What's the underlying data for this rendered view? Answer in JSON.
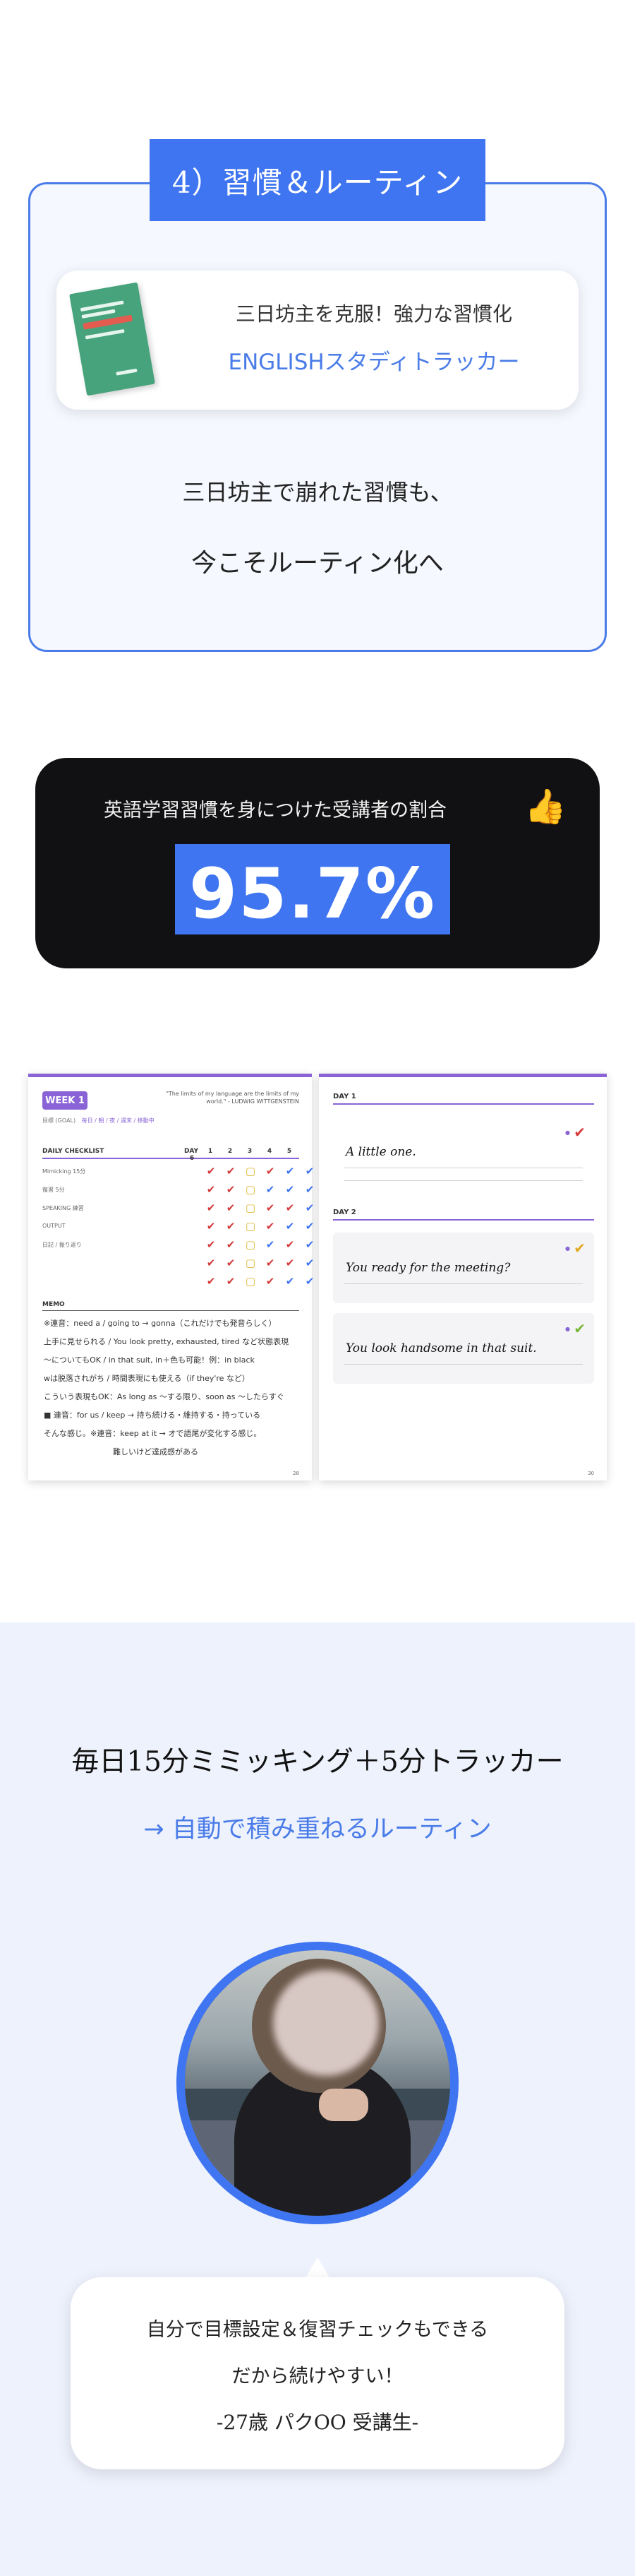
{
  "section1": {
    "title": "4）習慣＆ルーティン",
    "tracker_line1": "三日坊主を克服！強力な習慣化",
    "tracker_line2": "ENGLISHスタディトラッカー",
    "message_line1": "三日坊主で崩れた習慣も、",
    "message_line2": "今こそルーティン化へ"
  },
  "stat": {
    "label": "英語学習習慣を身につけた受講者の割合",
    "icon": "thumbs-up-icon",
    "value": "95.7%"
  },
  "worksheet": {
    "left": {
      "week": "WEEK 1",
      "quote": "\"The limits of my language are the limits of my world.\" - LUDWIG WITTGENSTEIN",
      "goal_label": "目標 (GOAL)",
      "goal_tags": "毎日 / 朝 / 夜 / 週末 / 移動中",
      "checklist_title": "DAILY CHECKLIST",
      "day_label": "DAY",
      "days": [
        "1",
        "2",
        "3",
        "4",
        "5",
        "6"
      ],
      "checklist_items": [
        "Mimicking 15分",
        "復習 5分",
        "SPEAKING 練習",
        "OUTPUT",
        "日記 / 振り返り",
        "",
        ""
      ],
      "memo_title": "MEMO",
      "memo_lines": [
        "※連音：need a / going to → gonna（これだけでも発音らしく）",
        "上手に見せられる / You look pretty, exhausted, tired など状態表現",
        "～についてもOK / in that suit, in＋色も可能！例：in black",
        "wは脱落されがち / 時間表現にも使える（if they're など）",
        "こういう表現もOK：As long as ～する限り、soon as ～したらすぐ",
        "■ 連音：for us / keep → 持ち続ける・維持する・持っている",
        "そんな感じ。※連音：keep at it → オで語尾が変化する感じ。",
        "難しいけど達成感がある"
      ],
      "page": "28"
    },
    "right": {
      "day1_title": "DAY 1",
      "day2_title": "DAY 2",
      "entries": [
        {
          "handwriting": "A little one."
        },
        {
          "handwriting": "You ready for the meeting?"
        },
        {
          "handwriting": "You look handsome in that suit."
        }
      ],
      "page": "30"
    }
  },
  "section4": {
    "title": "毎日15分ミミッキング＋5分トラッカー",
    "subtitle": "→ 自動で積み重ねるルーティン",
    "testimonial_line1": "自分で目標設定＆復習チェックもできる",
    "testimonial_line2": "だから続けやすい！",
    "testimonial_line3": "-27歳 パクOO 受講生-"
  },
  "colors": {
    "accent_blue": "#3f75f0",
    "purple": "#8a64d6",
    "dark_card": "#111113",
    "section_bg": "#eef2fd"
  }
}
